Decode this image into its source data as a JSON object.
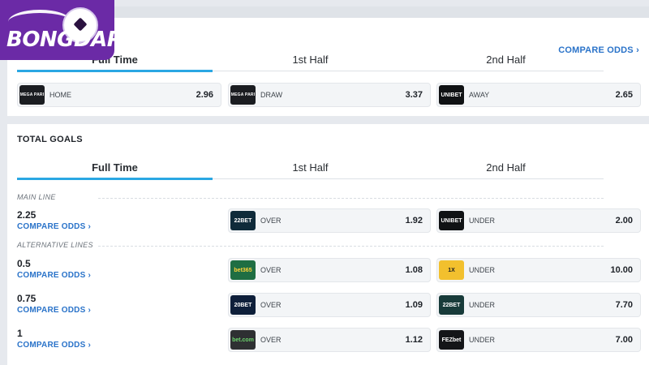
{
  "brand": {
    "name": "BONGDAPI",
    "colors": {
      "primary": "#6b2aa6",
      "accent": "#2aa7e3",
      "link": "#2a73c9"
    }
  },
  "match_odds": {
    "compare_label": "COMPARE ODDS",
    "compare_icon": "chevron-right-icon",
    "tabs": [
      {
        "label": "Full Time",
        "active": true
      },
      {
        "label": "1st Half",
        "active": false
      },
      {
        "label": "2nd Half",
        "active": false
      }
    ],
    "odds": [
      {
        "bookmaker": "MEGA PARI",
        "logo_text": "MEGA PARI",
        "label": "HOME",
        "value": "2.96"
      },
      {
        "bookmaker": "MEGA PARI",
        "logo_text": "MEGA PARI",
        "label": "DRAW",
        "value": "3.37"
      },
      {
        "bookmaker": "UNIBET",
        "logo_text": "UNIBET",
        "label": "AWAY",
        "value": "2.65"
      }
    ]
  },
  "total_goals": {
    "title": "TOTAL GOALS",
    "tabs": [
      {
        "label": "Full Time",
        "active": true
      },
      {
        "label": "1st Half",
        "active": false
      },
      {
        "label": "2nd Half",
        "active": false
      }
    ],
    "main_line_label": "MAIN LINE",
    "alt_lines_label": "ALTERNATIVE LINES",
    "compare_label": "COMPARE ODDS",
    "lines": [
      {
        "line": "2.25",
        "over": {
          "bookmaker": "22BET",
          "logo_text": "22BET",
          "label": "OVER",
          "value": "1.92"
        },
        "under": {
          "bookmaker": "UNIBET",
          "logo_text": "UNIBET",
          "label": "UNDER",
          "value": "2.00"
        }
      },
      {
        "line": "0.5",
        "over": {
          "bookmaker": "bet365",
          "logo_text": "bet365",
          "label": "OVER",
          "value": "1.08"
        },
        "under": {
          "bookmaker": "1xBet",
          "logo_text": "1X",
          "label": "UNDER",
          "value": "10.00"
        }
      },
      {
        "line": "0.75",
        "over": {
          "bookmaker": "20BET",
          "logo_text": "20BET",
          "label": "OVER",
          "value": "1.09"
        },
        "under": {
          "bookmaker": "22BET",
          "logo_text": "22BET",
          "label": "UNDER",
          "value": "7.70"
        }
      },
      {
        "line": "1",
        "over": {
          "bookmaker": "bet.com",
          "logo_text": "bet.com",
          "label": "OVER",
          "value": "1.12"
        },
        "under": {
          "bookmaker": "FEZbet",
          "logo_text": "FEZbet",
          "label": "UNDER",
          "value": "7.00"
        }
      }
    ]
  }
}
